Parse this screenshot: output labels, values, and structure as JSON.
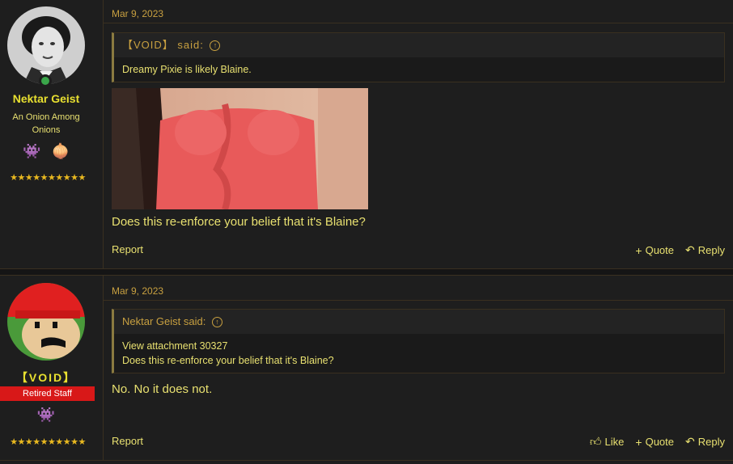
{
  "post1": {
    "user": {
      "name": "Nektar Geist",
      "title": "An Onion Among Onions",
      "badges": [
        "👾",
        "🧅"
      ],
      "stars": "★★★★★★★★★★"
    },
    "date": "Mar 9, 2023",
    "quote": {
      "author": "【VOID】 said:",
      "text": "Dreamy Pixie is likely Blaine."
    },
    "message": "Does this re-enforce your belief that it's Blaine?",
    "actions": {
      "report": "Report",
      "quote": "Quote",
      "reply": "Reply"
    }
  },
  "post2": {
    "user": {
      "name": "【VOID】",
      "banner": "Retired Staff",
      "badges": [
        "👾"
      ],
      "stars": "★★★★★★★★★★"
    },
    "date": "Mar 9, 2023",
    "quote": {
      "author": "Nektar Geist said:",
      "line1": "View attachment 30327",
      "line2": "Does this re-enforce your belief that it's Blaine?"
    },
    "message": "No. No it does not.",
    "actions": {
      "report": "Report",
      "like": "Like",
      "quote": "Quote",
      "reply": "Reply"
    }
  },
  "icons": {
    "quote_up": "arrow-up-circle-icon",
    "plus": "plus-icon",
    "reply": "reply-icon",
    "like": "thumbs-up-icon"
  },
  "colors": {
    "accent": "#e8e030",
    "background": "#1e1e1e",
    "banner": "#d81818",
    "online": "#3aa64a"
  }
}
